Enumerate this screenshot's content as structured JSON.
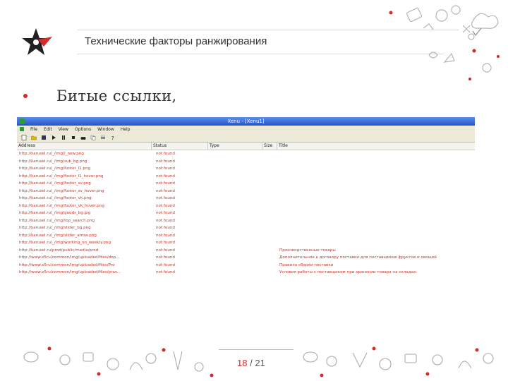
{
  "slide": {
    "title": "Технические факторы ранжирования",
    "bullet": "Битые ссылки,",
    "page_current": "18",
    "page_sep": "/",
    "page_total": "21"
  },
  "xenu": {
    "window_title": "Xenu - [Xenu1]",
    "menu": [
      "File",
      "Edit",
      "View",
      "Options",
      "Window",
      "Help"
    ],
    "columns": [
      "Address",
      "Status",
      "Type",
      "Size",
      "Title"
    ],
    "rows": [
      {
        "address": "http://karusel.ru/_/img/l_new.png",
        "status": "not found",
        "title": ""
      },
      {
        "address": "http://karusel.ru/_/img/sub_bg.png",
        "status": "not found",
        "title": ""
      },
      {
        "address": "http://karusel.ru/_/img/footer_l1.png",
        "status": "not found",
        "title": ""
      },
      {
        "address": "http://karusel.ru/_/img/footer_l1_hover.png",
        "status": "not found",
        "title": ""
      },
      {
        "address": "http://karusel.ru/_/img/footer_sv.png",
        "status": "not found",
        "title": ""
      },
      {
        "address": "http://karusel.ru/_/img/footer_sv_hover.png",
        "status": "not found",
        "title": ""
      },
      {
        "address": "http://karusel.ru/_/img/footer_vk.png",
        "status": "not found",
        "title": ""
      },
      {
        "address": "http://karusel.ru/_/img/footer_vk_hover.png",
        "status": "not found",
        "title": ""
      },
      {
        "address": "http://karusel.ru/_/img/goods_bg.jpg",
        "status": "not found",
        "title": ""
      },
      {
        "address": "http://karusel.ru/_/img/top_search.png",
        "status": "not found",
        "title": ""
      },
      {
        "address": "http://karusel.ru/_/img/slider_bg.png",
        "status": "not found",
        "title": ""
      },
      {
        "address": "http://karusel.ru/_/img/slider_arrow.png",
        "status": "not found",
        "title": ""
      },
      {
        "address": "http://karusel.ru/_/img/working_on_weekly.png",
        "status": "not found",
        "title": ""
      },
      {
        "address": "http://karusel.ru/prod/public/media/prod",
        "status": "not found",
        "title": "Производственные товары"
      },
      {
        "address": "http://www.x5ru/common/img/uploaded/files/dop...",
        "status": "not found",
        "title": "Дополнительное к договору поставки для поставщиков фруктов и овощей"
      },
      {
        "address": "http://www.x5ru/common/img/uploaded/files/Pro",
        "status": "not found",
        "title": "Правила сборки поставки"
      },
      {
        "address": "http://www.x5ru/common/img/uploaded/files/prav...",
        "status": "not found",
        "title": "Условия работы с поставщиком при хранении товара на складах"
      }
    ]
  },
  "colors": {
    "accent_red": "#d12b2b",
    "xenu_titlebar": "#2554c7",
    "link_red": "#c0392b"
  }
}
